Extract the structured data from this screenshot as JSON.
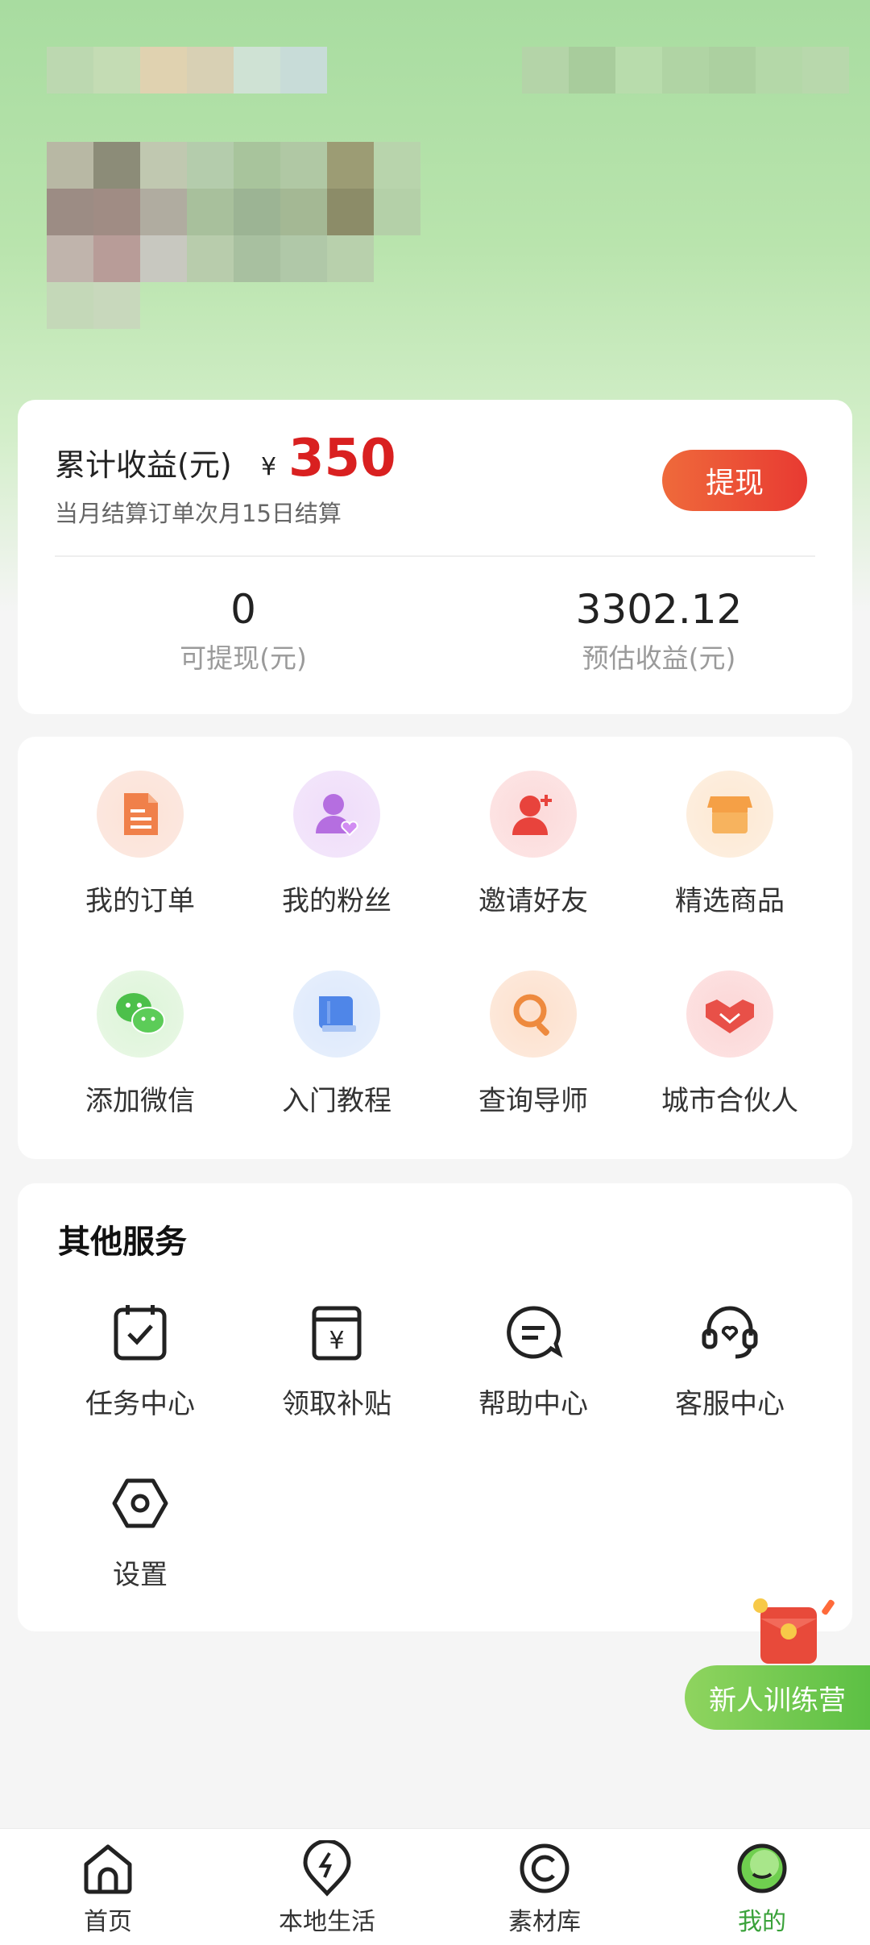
{
  "earnings": {
    "title": "累计收益(元)",
    "currency": "¥",
    "amount": "350",
    "note": "当月结算订单次月15日结算",
    "withdraw_label": "提现",
    "withdrawable_value": "0",
    "withdrawable_label": "可提现(元)",
    "estimated_value": "3302.12",
    "estimated_label": "预估收益(元)"
  },
  "menu": {
    "items": [
      {
        "label": "我的订单",
        "icon": "order-icon"
      },
      {
        "label": "我的粉丝",
        "icon": "fans-icon"
      },
      {
        "label": "邀请好友",
        "icon": "invite-friend-icon"
      },
      {
        "label": "精选商品",
        "icon": "store-icon"
      },
      {
        "label": "添加微信",
        "icon": "wechat-icon"
      },
      {
        "label": "入门教程",
        "icon": "book-icon"
      },
      {
        "label": "查询导师",
        "icon": "search-icon"
      },
      {
        "label": "城市合伙人",
        "icon": "handshake-icon"
      }
    ]
  },
  "services": {
    "title": "其他服务",
    "items": [
      {
        "label": "任务中心",
        "icon": "task-icon"
      },
      {
        "label": "领取补贴",
        "icon": "subsidy-icon"
      },
      {
        "label": "帮助中心",
        "icon": "help-chat-icon"
      },
      {
        "label": "客服中心",
        "icon": "headset-icon"
      },
      {
        "label": "设置",
        "icon": "settings-icon"
      }
    ]
  },
  "promo": {
    "label": "新人训练营"
  },
  "tabbar": {
    "items": [
      {
        "label": "首页",
        "icon": "home-icon"
      },
      {
        "label": "本地生活",
        "icon": "local-life-icon"
      },
      {
        "label": "素材库",
        "icon": "materials-icon"
      },
      {
        "label": "我的",
        "icon": "profile-icon",
        "active": true
      }
    ]
  },
  "colors": {
    "accent_red": "#d92020",
    "brand_green": "#3aa23a"
  }
}
